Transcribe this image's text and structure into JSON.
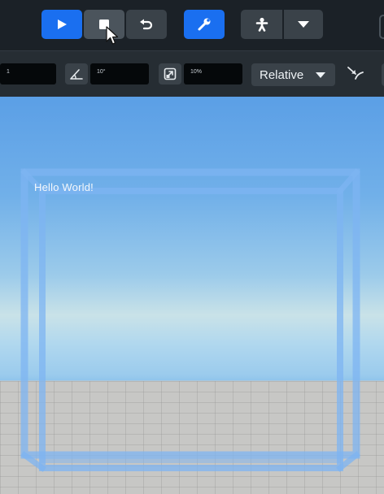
{
  "toolbar": {
    "play_icon": "play-icon",
    "stop_icon": "stop-icon",
    "undo_icon": "undo-icon",
    "tools_icon": "wrench-icon",
    "avatar_icon": "person-icon",
    "dropdown_icon": "chevron-down-icon"
  },
  "transform": {
    "move_value": "1",
    "rotate_value": "10°",
    "scale_value": "10%",
    "space_mode": "Relative"
  },
  "viewport": {
    "label_text": "Hello World!"
  },
  "colors": {
    "accent": "#1a6ff0",
    "toolbar_bg": "#1b2127",
    "button_dark": "#3a4249"
  }
}
